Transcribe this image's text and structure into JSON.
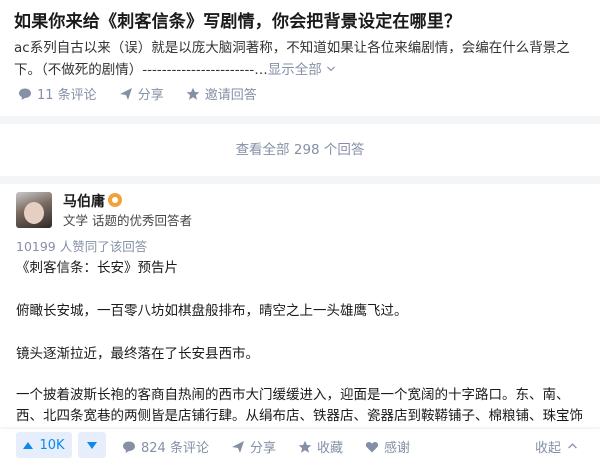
{
  "question": {
    "title": "如果你来给《刺客信条》写剧情，你会把背景设定在哪里？",
    "description": "ac系列自古以来（误）就是以庞大脑洞著称，不知道如果让各位来编剧情，会编在什么背景之下。（不做死的剧情）-----------------------…",
    "show_all": "显示全部",
    "actions": {
      "comments": "11 条评论",
      "share": "分享",
      "invite": "邀请回答"
    }
  },
  "view_all_answers": "查看全部 298 个回答",
  "answer": {
    "author_name": "马伯庸",
    "author_bio": "文学 话题的优秀回答者",
    "upvote_text": "10199 人赞同了该回答",
    "paragraphs": [
      "《刺客信条：长安》预告片",
      "俯瞰长安城，一百零八坊如棋盘般排布，晴空之上一头雄鹰飞过。",
      "镜头逐渐拉近，最终落在了长安县西市。",
      "一个披着波斯长袍的客商自热闹的西市大门缓缓进入，迎面是一个宽阔的十字路口。东、南、西、北四条宽巷的两侧皆是店铺行肆。从绢布店、铁器店、瓷器店到鞍鞯铺子、棉粮铺、珠宝饰"
    ],
    "bottom_bar": {
      "vote_count": "10K",
      "comments": "824 条评论",
      "share": "分享",
      "favorite": "收藏",
      "thanks": "感谢",
      "collapse": "收起"
    }
  },
  "colors": {
    "accent": "#0f88eb",
    "muted": "#8590a6",
    "background": "#f4f5f7"
  }
}
